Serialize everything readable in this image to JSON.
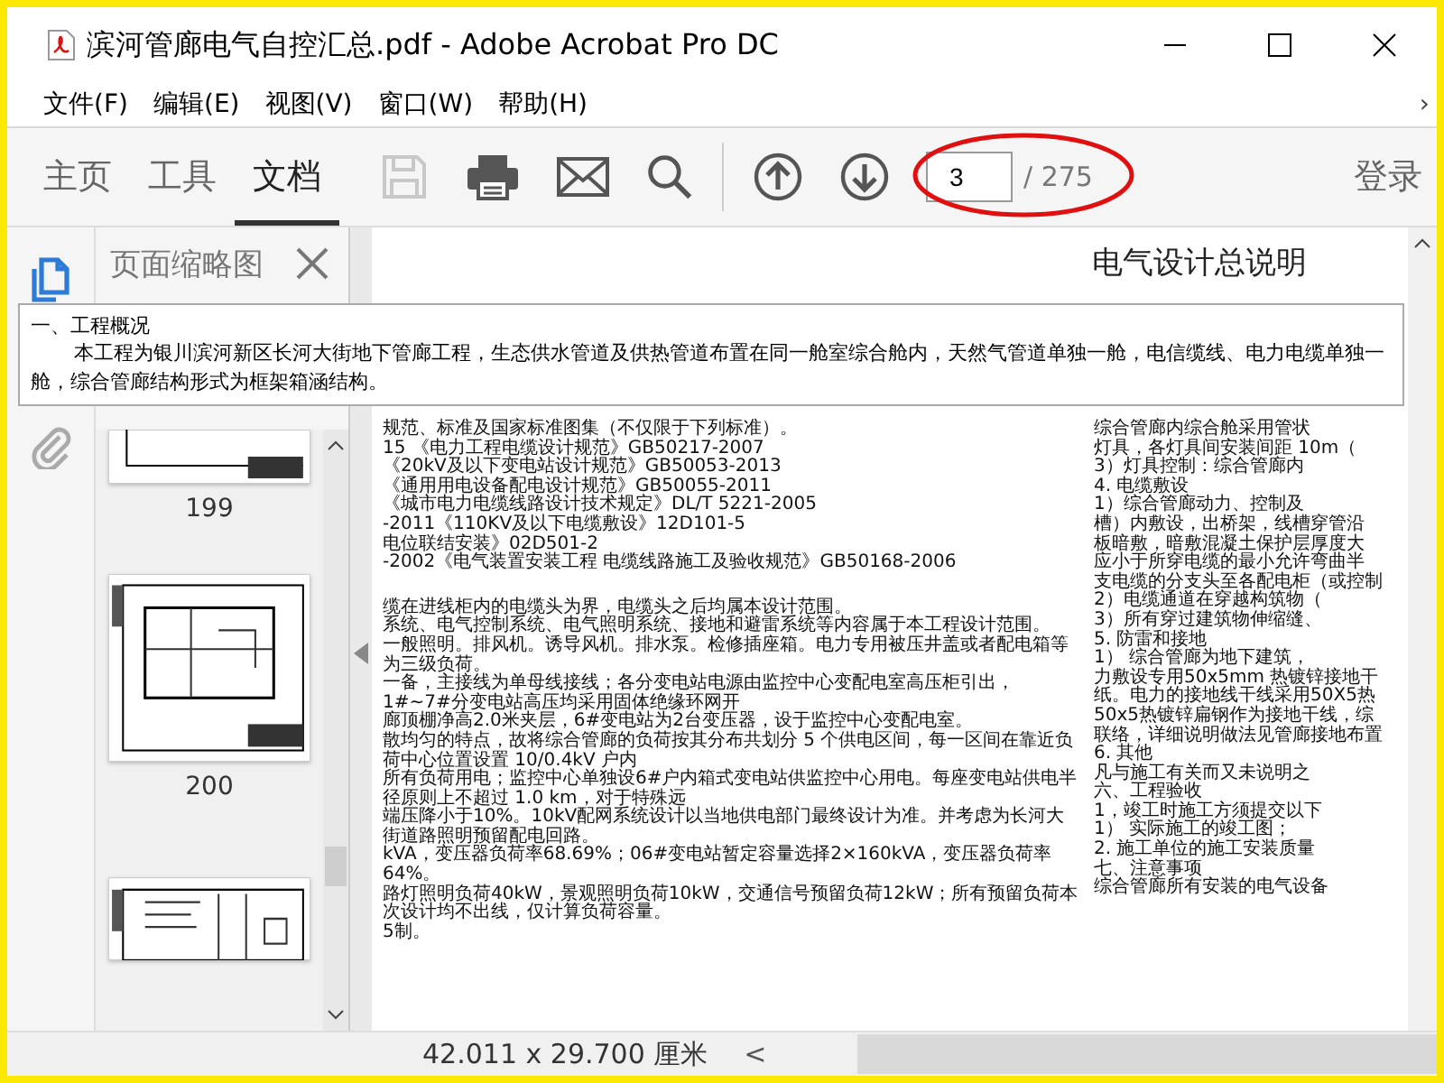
{
  "window": {
    "title": "滨河管廊电气自控汇总.pdf - Adobe Acrobat Pro DC"
  },
  "menu": [
    {
      "label": "文件(F)"
    },
    {
      "label": "编辑(E)"
    },
    {
      "label": "视图(V)"
    },
    {
      "label": "窗口(W)"
    },
    {
      "label": "帮助(H)"
    }
  ],
  "menu_more": "›",
  "toolbar": {
    "tabs": [
      {
        "label": "主页",
        "selected": false
      },
      {
        "label": "工具",
        "selected": false
      },
      {
        "label": "文档",
        "selected": true
      }
    ],
    "tools": [
      {
        "kind": "save",
        "disabled": true
      },
      {
        "kind": "print",
        "disabled": false
      },
      {
        "kind": "mail",
        "disabled": false
      },
      {
        "kind": "search",
        "disabled": false
      },
      {
        "kind": "prev",
        "disabled": false
      },
      {
        "kind": "next",
        "disabled": false
      }
    ],
    "page_field": {
      "value": "3"
    },
    "page_count": "/ 275",
    "sign_in": "登录"
  },
  "sidebar": {
    "rail": [
      {
        "kind": "pages",
        "selected": true
      },
      {
        "kind": "attachments",
        "selected": false
      }
    ],
    "panel_title": "页面缩略图",
    "thumbnails": [
      {
        "label": "199"
      },
      {
        "label": "200"
      }
    ]
  },
  "popup": {
    "heading": "一、工程概况",
    "text": "本工程为银川滨河新区长河大街地下管廊工程，生态供水管道及供热管道布置在同一舱室综合舱内，天然气管道单独一舱，电信缆线、电力电缆单独一舱，综合管廊结构形式为框架箱涵结构。"
  },
  "document": {
    "title": "电气设计总说明",
    "left_column": [
      "规范、标准及国家标准图集（不仅限于下列标准）。",
      "15 《电力工程电缆设计规范》GB50217-2007",
      "《20kV及以下变电站设计规范》GB50053-2013",
      "《通用用电设备配电设计规范》GB50055-2011",
      "《城市电力电缆线路设计技术规定》DL/T 5221-2005",
      "-2011《110KV及以下电缆敷设》12D101-5",
      "电位联结安装》02D501-2",
      "-2002《电气装置安装工程 电缆线路施工及验收规范》GB50168-2006",
      "缆在进线柜内的电缆头为界，电缆头之后均属本设计范围。",
      "系统、电气控制系统、电气照明系统、接地和避雷系统等内容属于本工程设计范围。",
      "一般照明。排风机。诱导风机。排水泵。检修插座箱。电力专用被压井盖或者配电箱等为三级负荷。",
      "一备，主接线为单母线接线；各分变电站电源由监控中心变配电室高压柜引出，1#~7#分变电站高压均采用固体绝缘环网开",
      "廊顶棚净高2.0米夹层，6#变电站为2台变压器，设于监控中心变配电室。",
      "散均匀的特点，故将综合管廊的负荷按其分布共划分 5 个供电区间，每一区间在靠近负荷中心位置设置 10/0.4kV 户内",
      "所有负荷用电；监控中心单独设6#户内箱式变电站供监控中心用电。每座变电站供电半径原则上不超过 1.0 km，对于特殊远",
      "端压降小于10%。10kV配网系统设计以当地供电部门最终设计为准。并考虑为长河大街道路照明预留配电回路。",
      "kVA，变压器负荷率68.69%；06#变电站暂定容量选择2×160kVA，变压器负荷率64%。",
      "路灯照明负荷40kW，景观照明负荷10kW，交通信号预留负荷12kW；所有预留负荷本次设计均不出线，仅计算负荷容量。",
      "5制。"
    ],
    "right_column": [
      "综合管廊内综合舱采用管状",
      "灯具，各灯具间安装间距 10m（",
      "3）灯具控制：综合管廊内",
      "4. 电缆敷设",
      "1）综合管廊动力、控制及",
      "槽）内敷设，出桥架，线槽穿管沿",
      "板暗敷，暗敷混凝土保护层厚度大",
      "应小于所穿电缆的最小允许弯曲半",
      "支电缆的分支头至各配电柜（或控制",
      "2）电缆通道在穿越构筑物（",
      "3）所有穿过建筑物伸缩缝、",
      "5. 防雷和接地",
      "1） 综合管廊为地下建筑，",
      "力敷设专用50x5mm 热镀锌接地干",
      "纸。电力的接地线干线采用50X5热",
      "50x5热镀锌扁钢作为接地干线，综",
      "联络，详细说明做法见管廊接地布置",
      "6. 其他",
      "凡与施工有关而又未说明之",
      "六、工程验收",
      "1，竣工时施工方须提交以下",
      "1） 实际施工的竣工图；",
      "2. 施工单位的施工安装质量",
      "七、注意事项",
      "综合管廊所有安装的电气设备"
    ]
  },
  "status_bar": {
    "page_size": "42.011 x 29.700 厘米",
    "scroll_left": "<"
  }
}
